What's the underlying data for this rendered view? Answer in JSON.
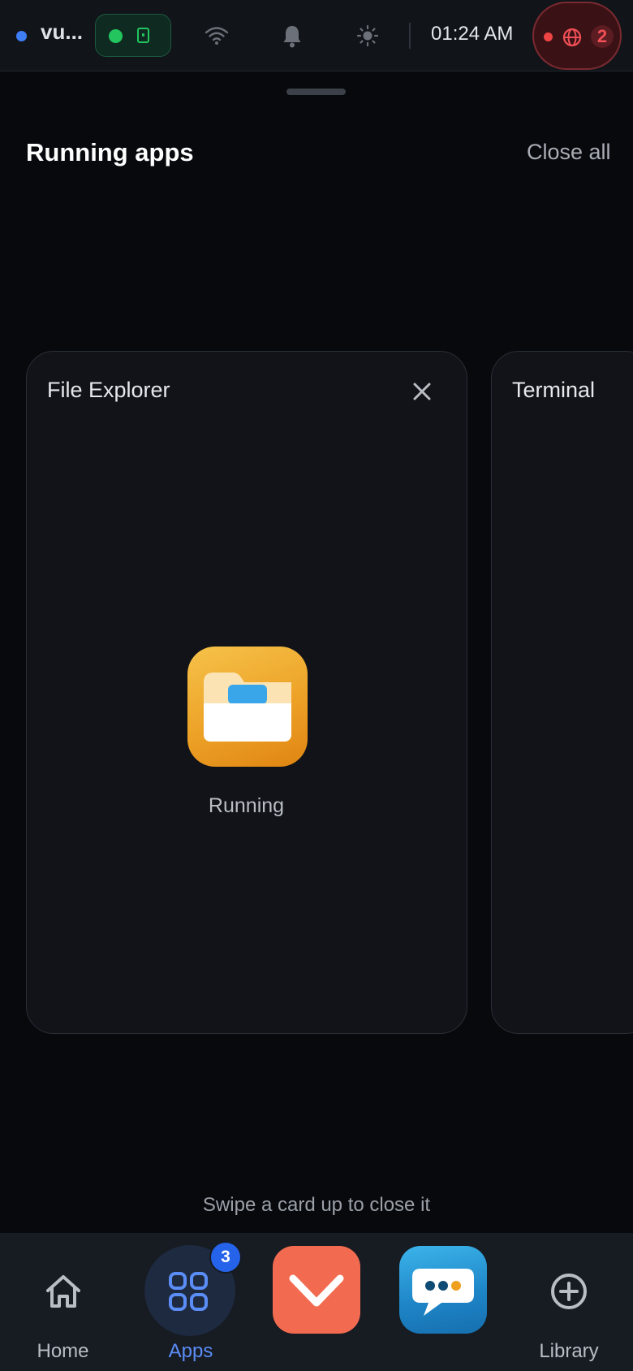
{
  "status_bar": {
    "device_name": "vu...",
    "time": "01:24 AM",
    "alert_count": "2",
    "icons": [
      "dot-blue-icon",
      "vpn-icon",
      "wifi-icon",
      "bell-icon",
      "brightness-icon",
      "globe-icon"
    ]
  },
  "sheet": {
    "title": "Running apps",
    "close_all_label": "Close all",
    "hint": "Swipe a card up to close it"
  },
  "cards": [
    {
      "title": "File Explorer",
      "status": "Running",
      "icon": "folder-icon"
    },
    {
      "title": "Terminal"
    }
  ],
  "dock": {
    "home_label": "Home",
    "apps_label": "Apps",
    "apps_badge": "3",
    "library_label": "Library",
    "colors": {
      "active": "#5b8df7",
      "red_tile": "#f26b50",
      "blue_tile": "#1d84c6"
    }
  }
}
